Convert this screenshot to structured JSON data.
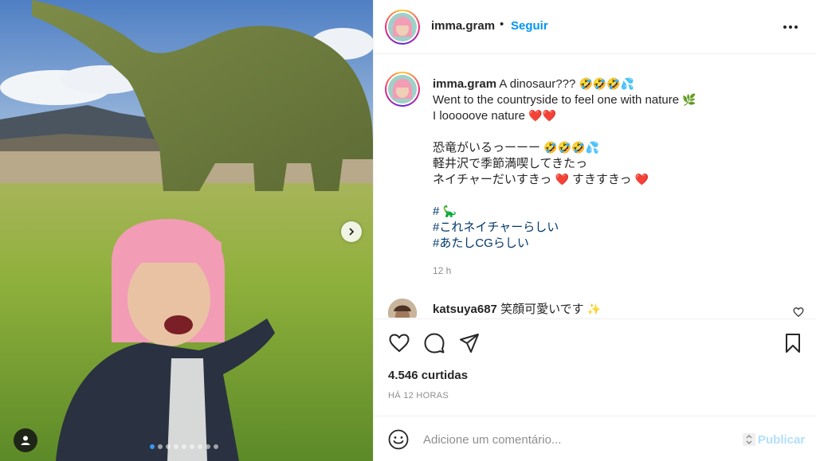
{
  "header": {
    "username": "imma.gram",
    "separator": "•",
    "follow_label": "Seguir"
  },
  "caption": {
    "username": "imma.gram",
    "lines": [
      "A dinosaur???",
      "Went to the countryside to feel one with nature",
      "I looooove nature",
      "",
      "恐竜がいるっーーー",
      "軽井沢で季節満喫してきたっ",
      "ネイチャーだいすきっ",
      "すきすきっ",
      "#",
      "#これネイチャーらしい",
      "#あたしCGらしい"
    ],
    "emojis": {
      "line1": "🤣🤣🤣💦",
      "line2": "🌿",
      "line3": "❤️❤️",
      "line5": "🤣🤣🤣💦",
      "line7a": "❤️",
      "line7b": "❤️",
      "line9": "🦕"
    },
    "timestamp": "12 h"
  },
  "comments": [
    {
      "username": "katsuya687",
      "text": "笑顔可愛いです",
      "emoji": "✨"
    }
  ],
  "actions": {
    "like_icon": "heart-icon",
    "comment_icon": "comment-icon",
    "share_icon": "paper-plane-icon",
    "save_icon": "bookmark-icon",
    "likes_text": "4.546 curtidas",
    "posted_ago": "HÁ 12 HORAS"
  },
  "add_comment": {
    "placeholder": "Adicione um comentário...",
    "publish_label": "Publicar"
  },
  "carousel": {
    "total_slides": 9,
    "active_index": 0
  },
  "colors": {
    "accent": "#0095f6",
    "publish_disabled": "#b2dffc",
    "hashtag": "#00376b",
    "muted": "#8e8e8e"
  }
}
